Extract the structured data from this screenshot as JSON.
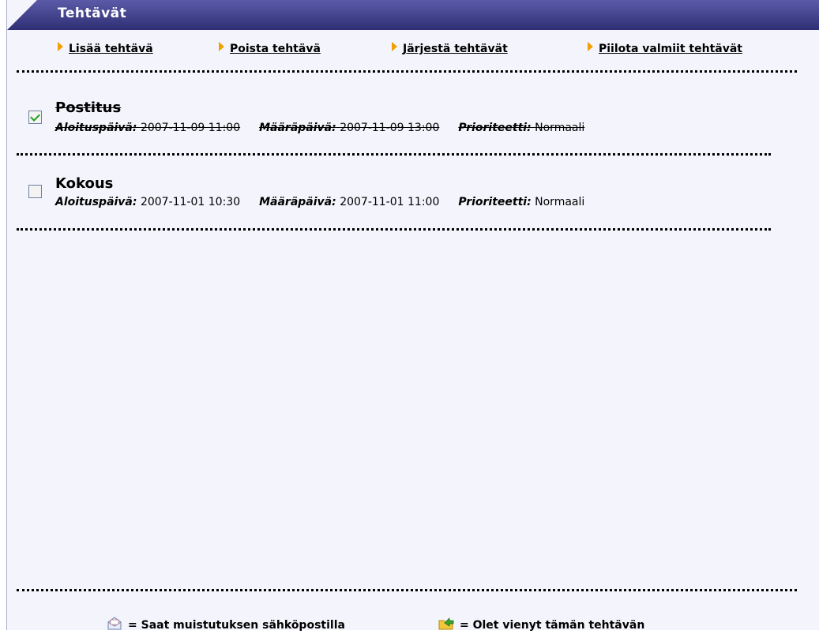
{
  "window": {
    "title": "Tehtävät"
  },
  "toolbar": {
    "add_label": "Lisää tehtävä",
    "delete_label": "Poista tehtävä",
    "sort_label": "Järjestä tehtävät",
    "hide_done_label": "Piilota valmiit tehtävät"
  },
  "labels": {
    "start": "Aloituspäivä:",
    "due": "Määräpäivä:",
    "priority": "Prioriteetti:"
  },
  "tasks": [
    {
      "name": "Postitus",
      "start": "2007-11-09 11:00",
      "due": "2007-11-09 13:00",
      "priority": "Normaali",
      "done": true
    },
    {
      "name": "Kokous",
      "start": "2007-11-01 10:30",
      "due": "2007-11-01 11:00",
      "priority": "Normaali",
      "done": false
    }
  ],
  "legend": {
    "email_icon": "envelope-icon",
    "email_text": "= Saat muistutuksen sähköpostilla",
    "export_icon": "folder-export-icon",
    "export_text": "= Olet vienyt tämän tehtävän"
  },
  "colors": {
    "titlebar": "#3a3a82",
    "panel_bg": "#f4f5fc",
    "arrow": "#f0a000",
    "check": "#23a01c"
  }
}
